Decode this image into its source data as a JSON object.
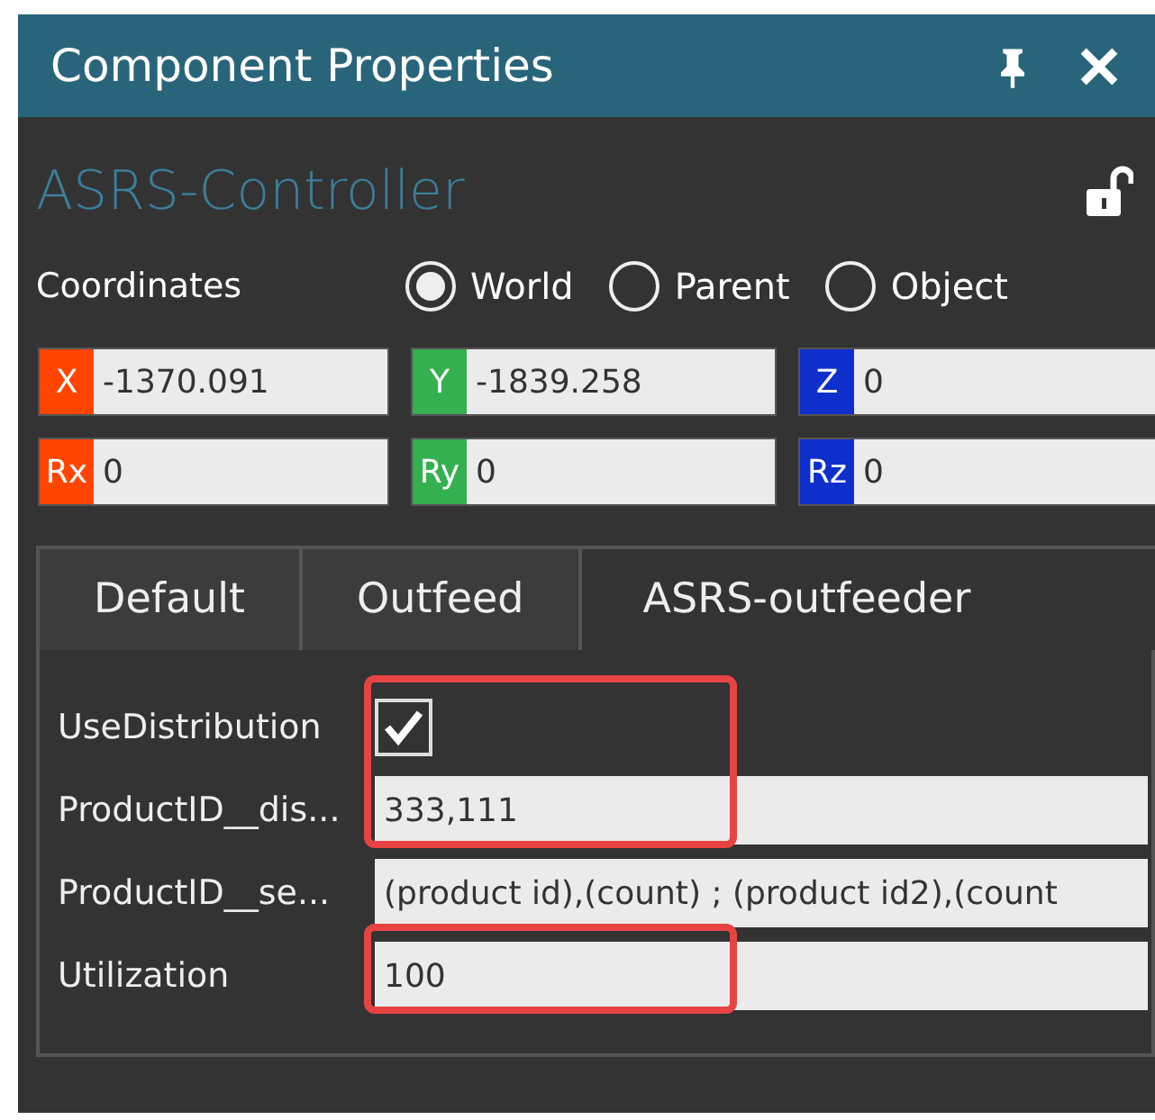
{
  "window": {
    "title": "Component Properties"
  },
  "component": {
    "name": "ASRS-Controller",
    "locked": false
  },
  "coordinates": {
    "label": "Coordinates",
    "options": [
      {
        "label": "World",
        "selected": true
      },
      {
        "label": "Parent",
        "selected": false
      },
      {
        "label": "Object",
        "selected": false
      }
    ]
  },
  "transform": [
    {
      "axis": "X",
      "value": "-1370.091",
      "color": "#ff4500"
    },
    {
      "axis": "Y",
      "value": "-1839.258",
      "color": "#34b050"
    },
    {
      "axis": "Z",
      "value": "0",
      "color": "#0f2fcc"
    },
    {
      "axis": "Rx",
      "value": "0",
      "color": "#ff4500"
    },
    {
      "axis": "Ry",
      "value": "0",
      "color": "#34b050"
    },
    {
      "axis": "Rz",
      "value": "0",
      "color": "#0f2fcc"
    }
  ],
  "tabs": [
    {
      "label": "Default",
      "selected": false
    },
    {
      "label": "Outfeed",
      "selected": false
    },
    {
      "label": "ASRS-outfeeder",
      "selected": true
    }
  ],
  "properties": [
    {
      "kind": "checkbox",
      "label": "UseDistribution",
      "checked": true,
      "highlighted": true
    },
    {
      "kind": "text",
      "label": "ProductID__dis...",
      "value": "333,111",
      "highlighted": true
    },
    {
      "kind": "text",
      "label": "ProductID__se...",
      "value": "(product id),(count) ; (product id2),(count",
      "highlighted": false
    },
    {
      "kind": "text",
      "label": "Utilization",
      "value": "100",
      "highlighted": true
    }
  ]
}
